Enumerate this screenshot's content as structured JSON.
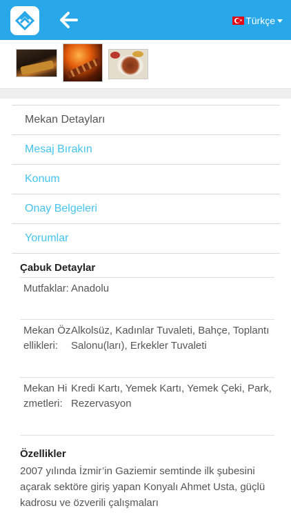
{
  "header": {
    "logo_icon": "app-logo-icon",
    "back_icon": "back-arrow-icon",
    "language": "Türkçe",
    "bg_color": "#28a8e8"
  },
  "gallery": {
    "images": [
      {
        "name": "grilled-dish-photo"
      },
      {
        "name": "kebab-skewer-photo"
      },
      {
        "name": "plated-meal-photo"
      }
    ]
  },
  "tabs": [
    {
      "label": "Mekan Detayları",
      "active": true
    },
    {
      "label": "Mesaj Bırakın",
      "active": false
    },
    {
      "label": "Konum",
      "active": false
    },
    {
      "label": "Onay Belgeleri",
      "active": false
    },
    {
      "label": "Yorumlar",
      "active": false
    }
  ],
  "quick_details": {
    "title": "Çabuk Detaylar",
    "rows": [
      {
        "key": "Mutfaklar:",
        "value": "Anadolu"
      },
      {
        "key": "Mekan Özellikleri:",
        "value": "Alkolsüz, Kadınlar Tuvaleti, Bahçe, Toplantı Salonu(ları), Erkekler Tuvaleti"
      },
      {
        "key": "Mekan Hizmetleri:",
        "value": "Kredi Kartı, Yemek Kartı, Yemek Çeki, Park, Rezervasyon"
      }
    ]
  },
  "features": {
    "title": "Özellikler",
    "text": "2007 yılında İzmir’in Gaziemir semtinde ilk şubesini açarak sektöre giriş yapan Konyalı Ahmet Usta, güçlü kadrosu ve özverili çalışmaları"
  },
  "colors": {
    "accent": "#28a8e8",
    "link": "#45c3ee"
  }
}
